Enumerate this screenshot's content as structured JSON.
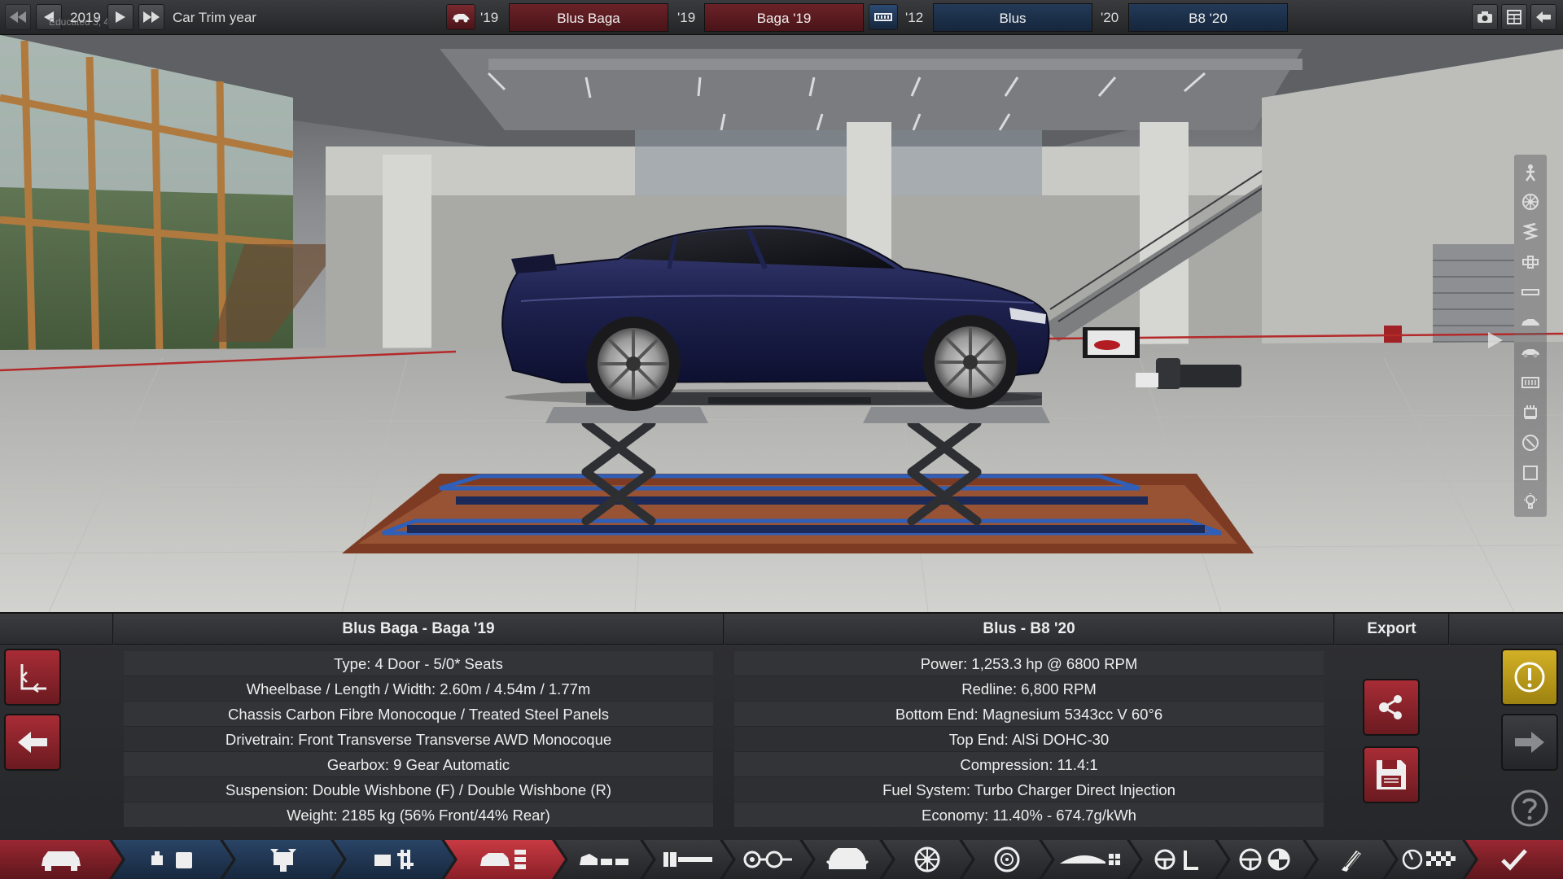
{
  "topbar": {
    "year_value": "2019",
    "background_watermark": "Educated 3, 4.0",
    "trim_year_label": "Car Trim year",
    "model_year_short": "'19",
    "model_name": "Blus Baga",
    "trim_year_short": "'19",
    "trim_name": "Baga '19",
    "engine_family_year_short": "'12",
    "engine_family_name": "Blus",
    "engine_variant_year_short": "'20",
    "engine_variant_name": "B8 '20",
    "icons": [
      "rewind-icon",
      "step-back-icon",
      "play-icon",
      "fast-forward-icon",
      "car-icon",
      "engine-icon",
      "camera-icon",
      "calculator-icon",
      "back-arrow-icon"
    ]
  },
  "sidetools": {
    "items": [
      "person-icon",
      "wheel-icon",
      "spring-icon",
      "tool-icon",
      "bar-icon",
      "car-body-icon",
      "car-side-icon",
      "grill-icon",
      "engine-block-icon",
      "gauge-icon",
      "square-icon",
      "light-icon"
    ]
  },
  "panel": {
    "car_heading": "Blus Baga - Baga '19",
    "engine_heading": "Blus - B8 '20",
    "export_heading": "Export",
    "car_specs": [
      "Type: 4 Door - 5/0* Seats",
      "Wheelbase / Length / Width: 2.60m / 4.54m / 1.77m",
      "Chassis Carbon Fibre Monocoque / Treated Steel Panels",
      "Drivetrain: Front Transverse Transverse AWD Monocoque",
      "Gearbox: 9 Gear Automatic",
      "Suspension: Double Wishbone (F) / Double Wishbone (R)",
      "Weight: 2185 kg (56% Front/44% Rear)"
    ],
    "engine_specs": [
      "Power: 1,253.3 hp @ 6800 RPM",
      "Redline:  6,800 RPM",
      "Bottom End: Magnesium 5343cc V 60°6",
      "Top End: AlSi DOHC-30",
      "Compression: 11.4:1",
      "Fuel System: Turbo Charger Direct Injection",
      "Economy: 11.40% - 674.7g/kWh"
    ]
  },
  "tabs": {
    "items": [
      "car-icon",
      "engine-parts-icon",
      "engine-icon",
      "engine-tune-icon",
      "car-trim-icon",
      "body-icon",
      "chassis-icon",
      "drivetrain-icon",
      "gearbox-icon",
      "suspension-icon",
      "brakes-icon",
      "aero-icon",
      "steering-icon",
      "safety-icon",
      "paint-icon",
      "test-icon",
      "confirm-icon"
    ]
  },
  "colors": {
    "accent_red": "#9a2832",
    "accent_blue": "#2a4466",
    "accent_gold": "#d2b026",
    "car_paint": "#1c1f4a"
  }
}
